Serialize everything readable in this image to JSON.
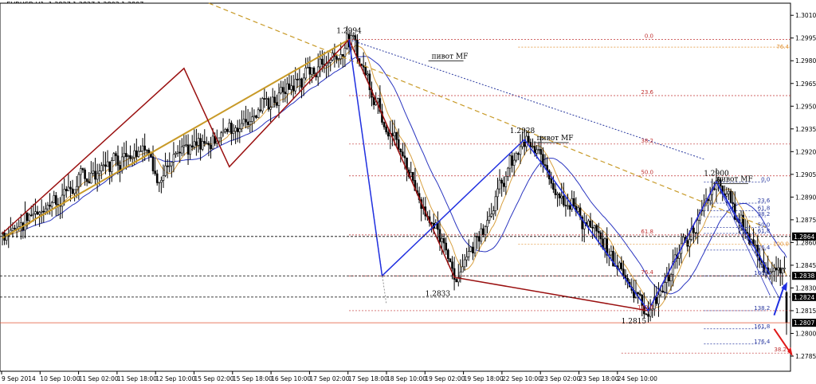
{
  "header": {
    "symbol": "EURUSD,H1",
    "ohlc": "1.2827 1.2827 1.2803 1.2807"
  },
  "colors": {
    "background": "#ffffff",
    "candle": "#000000",
    "wave_blue": "#1f2fe0",
    "wave_red": "#9a1010",
    "trend_gold": "#c89a28",
    "ma_blue": "#2a35c0",
    "ma_gold": "#d8a040",
    "fib_red": "#c03030",
    "fib_orange": "#e09030",
    "fib_blue": "#2a3aa0",
    "price_box": "#000000",
    "current_line": "#e05030"
  },
  "chart_data": {
    "type": "candlestick",
    "symbol": "EURUSD",
    "timeframe": "H1",
    "ylim": [
      1.2775,
      1.3018
    ],
    "y_ticks": [
      "1.3010",
      "1.2995",
      "1.2980",
      "1.2965",
      "1.2950",
      "1.2935",
      "1.2920",
      "1.2905",
      "1.2890",
      "1.2875",
      "1.2860",
      "1.2845",
      "1.2830",
      "1.2815",
      "1.2800",
      "1.2785"
    ],
    "x_ticks": [
      "9 Sep 2014",
      "10 Sep 10:00",
      "11 Sep 02:00",
      "11 Sep 18:00",
      "12 Sep 10:00",
      "15 Sep 02:00",
      "15 Sep 18:00",
      "16 Sep 10:00",
      "17 Sep 02:00",
      "17 Sep 18:00",
      "18 Sep 10:00",
      "19 Sep 02:00",
      "19 Sep 18:00",
      "22 Sep 10:00",
      "23 Sep 02:00",
      "23 Sep 18:00",
      "24 Sep 10:00"
    ],
    "price_labels": [
      {
        "text": "1.2864",
        "value": 1.2864
      },
      {
        "text": "1.2838",
        "value": 1.2838
      },
      {
        "text": "1.2824",
        "value": 1.2824
      },
      {
        "text": "1.2807",
        "value": 1.2807
      }
    ],
    "wave_points": [
      {
        "x": 0,
        "y": 1.2866
      },
      {
        "x": 68,
        "y": 1.2928
      },
      {
        "x": 73,
        "y": 1.2905
      },
      {
        "x": 132,
        "y": 1.2955
      },
      {
        "x": 168,
        "y": 1.2994
      },
      {
        "x": 219,
        "y": 1.2837
      },
      {
        "x": 252,
        "y": 1.2928
      },
      {
        "x": 313,
        "y": 1.2815
      },
      {
        "x": 346,
        "y": 1.29
      },
      {
        "x": 372,
        "y": 1.2839
      }
    ],
    "swing_labels": [
      {
        "text": "1.2994",
        "x": 168,
        "y": 1.2994
      },
      {
        "text": "1.2928",
        "x": 252,
        "y": 1.2928
      },
      {
        "text": "1.2900",
        "x": 346,
        "y": 1.29
      },
      {
        "text": "1.2833",
        "x": 211,
        "y": 1.2833
      },
      {
        "text": "1.2815",
        "x": 306,
        "y": 1.2815
      }
    ],
    "pivot_labels": [
      {
        "text": "пивот MF",
        "x": 208,
        "y": 1.2981
      },
      {
        "text": "пивот MF",
        "x": 259,
        "y": 1.2927
      },
      {
        "text": "пивот MF",
        "x": 346,
        "y": 1.29
      }
    ],
    "fib_large": [
      {
        "text": "0.0",
        "value": 1.2994
      },
      {
        "text": "23.6",
        "value": 1.2957
      },
      {
        "text": "38.2",
        "value": 1.2925
      },
      {
        "text": "50.0",
        "value": 1.2904
      },
      {
        "text": "61.8",
        "value": 1.2865
      },
      {
        "text": "76.4",
        "value": 1.2838
      },
      {
        "text": "100.0",
        "value": 1.2815
      },
      {
        "text": "38.2",
        "value": 1.2787
      }
    ],
    "fib_large_extra": [
      {
        "text": "76.4",
        "value": 1.2989
      },
      {
        "text": "100.0",
        "value": 1.2859
      }
    ],
    "fib_small": [
      {
        "text": "0.0",
        "value": 1.29
      },
      {
        "text": "23.6",
        "value": 1.2886
      },
      {
        "text": "61.8",
        "value": 1.2881
      },
      {
        "text": "38.2",
        "value": 1.2877
      },
      {
        "text": "50.0",
        "value": 1.287
      },
      {
        "text": "61.8",
        "value": 1.2866
      },
      {
        "text": "76.4",
        "value": 1.2855
      },
      {
        "text": "100.0",
        "value": 1.2838
      },
      {
        "text": "138.2",
        "value": 1.2815
      },
      {
        "text": "161.8",
        "value": 1.2803
      },
      {
        "text": "176.4",
        "value": 1.2793
      }
    ]
  }
}
